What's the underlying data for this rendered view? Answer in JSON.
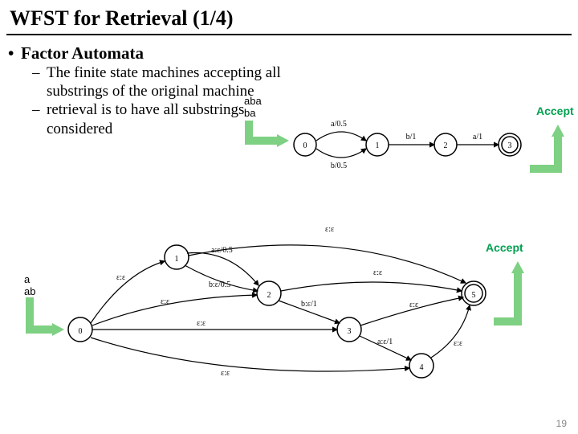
{
  "title": "WFST for Retrieval (1/4)",
  "bullets": {
    "l1": "Factor Automata",
    "l2a": "The finite state machines accepting all substrings of the original machine",
    "l2b": "retrieval is to have all substrings considered"
  },
  "labels": {
    "aba": "aba",
    "ba": "ba",
    "a": "a",
    "ab": "ab",
    "accept1": "Accept",
    "accept2": "Accept"
  },
  "top_fsm": {
    "states": [
      "0",
      "1",
      "2",
      "3"
    ],
    "final": "3",
    "edges": [
      {
        "from": "0",
        "to": "1",
        "label": "a/0.5",
        "curve": "up"
      },
      {
        "from": "0",
        "to": "1",
        "label": "b/0.5",
        "curve": "down"
      },
      {
        "from": "1",
        "to": "2",
        "label": "b/1",
        "curve": "straight"
      },
      {
        "from": "2",
        "to": "3",
        "label": "a/1",
        "curve": "straight"
      }
    ]
  },
  "bottom_fsm": {
    "states": [
      "0",
      "1",
      "2",
      "3",
      "4",
      "5"
    ],
    "final": "5",
    "eps": "ε:ε",
    "edges_labeled": [
      {
        "from": "1",
        "to": "2",
        "label": "a:ε/0.5"
      },
      {
        "from": "1",
        "to": "2",
        "label": "b:ε/0.5"
      },
      {
        "from": "2",
        "to": "3",
        "label": "b:ε/1"
      },
      {
        "from": "3",
        "to": "4",
        "label": "a:ε/1"
      }
    ]
  },
  "pagenum": "19"
}
